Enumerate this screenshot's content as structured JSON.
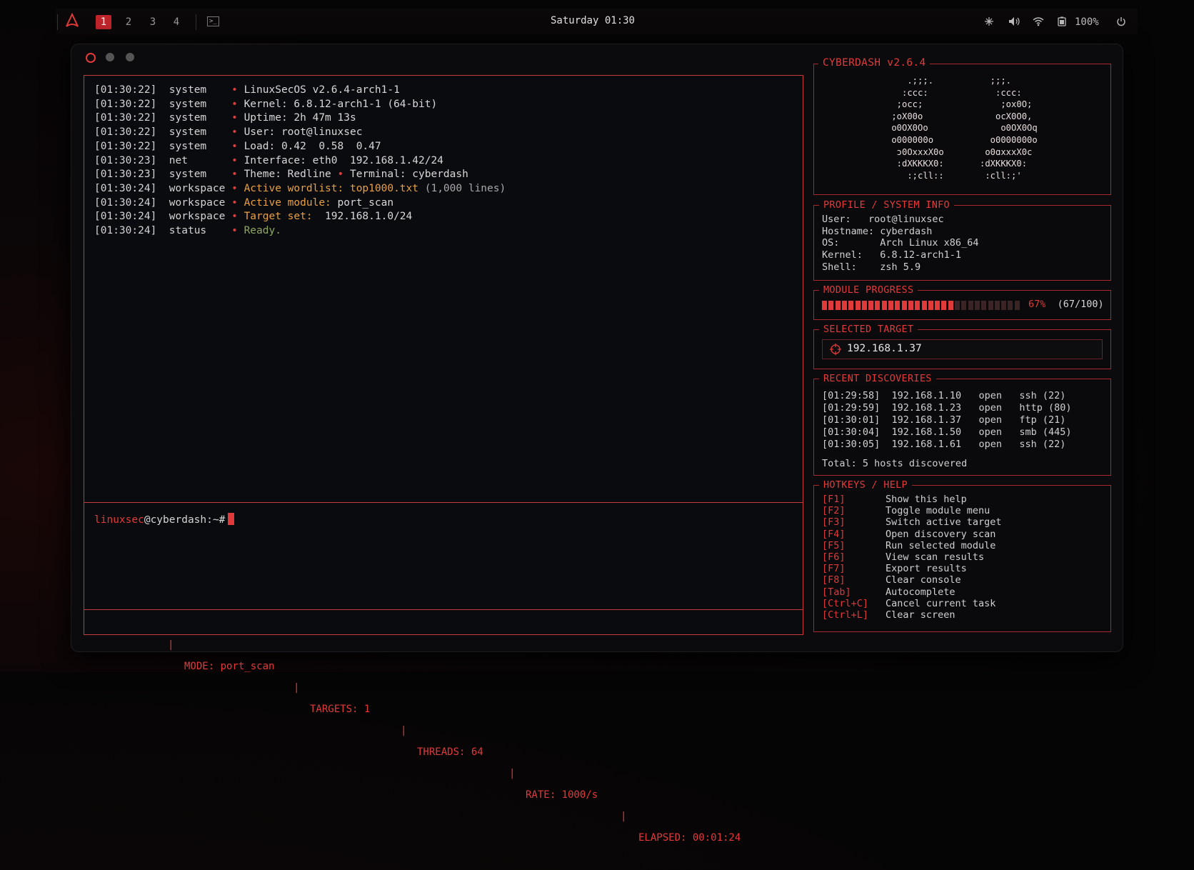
{
  "topbar": {
    "workspaces": [
      "1",
      "2",
      "3",
      "4"
    ],
    "active_workspace": "1",
    "clock": "Saturday 01:30",
    "battery": "100%",
    "icons": [
      "arch-logo-icon",
      "terminal-icon",
      "network-icon",
      "volume-icon",
      "wifi-icon",
      "battery-icon",
      "power-icon"
    ]
  },
  "terminal": {
    "log": [
      {
        "ts": "[01:30:22]",
        "src": "system   ",
        "parts": [
          {
            "t": "LinuxSecOS v2.6.4-arch1-1",
            "c": "val"
          }
        ]
      },
      {
        "ts": "[01:30:22]",
        "src": "system   ",
        "parts": [
          {
            "t": "Kernel: 6.8.12-arch1-1 (64-bit)",
            "c": "val"
          }
        ]
      },
      {
        "ts": "[01:30:22]",
        "src": "system   ",
        "parts": [
          {
            "t": "Uptime: 2h 47m 13s",
            "c": "val"
          }
        ]
      },
      {
        "ts": "[01:30:22]",
        "src": "system   ",
        "parts": [
          {
            "t": "User: root@linuxsec",
            "c": "val"
          }
        ]
      },
      {
        "ts": "[01:30:22]",
        "src": "system   ",
        "parts": [
          {
            "t": "Load: 0.42  0.58  0.47",
            "c": "val"
          }
        ]
      },
      {
        "ts": "[01:30:23]",
        "src": "net      ",
        "parts": [
          {
            "t": "Interface: eth0  192.168.1.42/24",
            "c": "val"
          }
        ]
      },
      {
        "ts": "[01:30:23]",
        "src": "system   ",
        "parts": [
          {
            "t": "Theme: Redline ",
            "c": "val"
          },
          {
            "t": "•",
            "c": "bul"
          },
          {
            "t": " Terminal: cyberdash",
            "c": "val"
          }
        ]
      },
      {
        "ts": "[01:30:24]",
        "src": "workspace",
        "parts": [
          {
            "t": "Active wordlist: top1000.txt",
            "c": "key"
          },
          {
            "t": " (1,000 lines)",
            "c": "dim"
          }
        ]
      },
      {
        "ts": "[01:30:24]",
        "src": "workspace",
        "parts": [
          {
            "t": "Active module:",
            "c": "key"
          },
          {
            "t": " port_scan",
            "c": "val"
          }
        ]
      },
      {
        "ts": "[01:30:24]",
        "src": "workspace",
        "parts": [
          {
            "t": "Target set:",
            "c": "key"
          },
          {
            "t": "  192.168.1.0/24",
            "c": "val"
          }
        ]
      },
      {
        "ts": "[01:30:24]",
        "src": "status   ",
        "parts": [
          {
            "t": "Ready.",
            "c": "ok"
          }
        ]
      }
    ],
    "prompt_user": "linuxsec",
    "prompt_host": "@cyberdash:~#",
    "status": {
      "mode": "MODE: port_scan",
      "targets": "TARGETS: 1",
      "threads": "THREADS: 64",
      "rate": "RATE: 1000/s",
      "elapsed": "ELAPSED: 00:01:24"
    }
  },
  "sidebar": {
    "logo_title": "CYBERDASH v2.6.4",
    "ascii_left": "    .;;;.\n   :ccc:\n  ;occ;\n ;oX00o\n o0OX0Oo\n o000000o\n  ɔ0OxxxX0o\n  :dXKKKX0:\n    :;cll::",
    "ascii_right": "  ;;;.\n   :ccc:\n    ;ox0O;\n   ocX0O0,\n    o0OX0Oq\n  o0000000o\n o0ɑxxxX0c\n:dXKKKX0:\n :cll:;'",
    "profile": {
      "title": "PROFILE / SYSTEM INFO",
      "rows": [
        "User:   root@linuxsec",
        "Hostname: cyberdash",
        "OS:       Arch Linux x86_64",
        "Kernel:   6.8.12-arch1-1",
        "Shell:    zsh 5.9"
      ]
    },
    "progress": {
      "title": "MODULE PROGRESS",
      "fraction": 0.67,
      "percent": "67%",
      "count": "(67/100)"
    },
    "target": {
      "title": "SELECTED TARGET",
      "value": "192.168.1.37"
    },
    "discoveries": {
      "title": "RECENT DISCOVERIES",
      "rows": [
        {
          "ts": "[01:29:58]",
          "ip": "192.168.1.10",
          "state": "open",
          "svc": "ssh (22)"
        },
        {
          "ts": "[01:29:59]",
          "ip": "192.168.1.23",
          "state": "open",
          "svc": "http (80)"
        },
        {
          "ts": "[01:30:01]",
          "ip": "192.168.1.37",
          "state": "open",
          "svc": "ftp (21)"
        },
        {
          "ts": "[01:30:04]",
          "ip": "192.168.1.50",
          "state": "open",
          "svc": "smb (445)"
        },
        {
          "ts": "[01:30:05]",
          "ip": "192.168.1.61",
          "state": "open",
          "svc": "ssh (22)"
        }
      ],
      "total": "Total: 5 hosts discovered"
    },
    "hotkeys": {
      "title": "HOTKEYS / HELP",
      "rows": [
        {
          "k": "[F1]",
          "d": "Show this help"
        },
        {
          "k": "[F2]",
          "d": "Toggle module menu"
        },
        {
          "k": "[F3]",
          "d": "Switch active target"
        },
        {
          "k": "[F4]",
          "d": "Open discovery scan"
        },
        {
          "k": "[F5]",
          "d": "Run selected module"
        },
        {
          "k": "[F6]",
          "d": "View scan results"
        },
        {
          "k": "[F7]",
          "d": "Export results"
        },
        {
          "k": "[F8]",
          "d": "Clear console"
        },
        {
          "k": "[Tab]",
          "d": "Autocomplete"
        },
        {
          "k": "[Ctrl+C]",
          "d": "Cancel current task"
        },
        {
          "k": "[Ctrl+L]",
          "d": "Clear screen"
        }
      ]
    }
  },
  "colors": {
    "accent": "#e03a3a",
    "warn": "#e8a044",
    "ok": "#8fa860",
    "panel_border": "#a8282c"
  }
}
